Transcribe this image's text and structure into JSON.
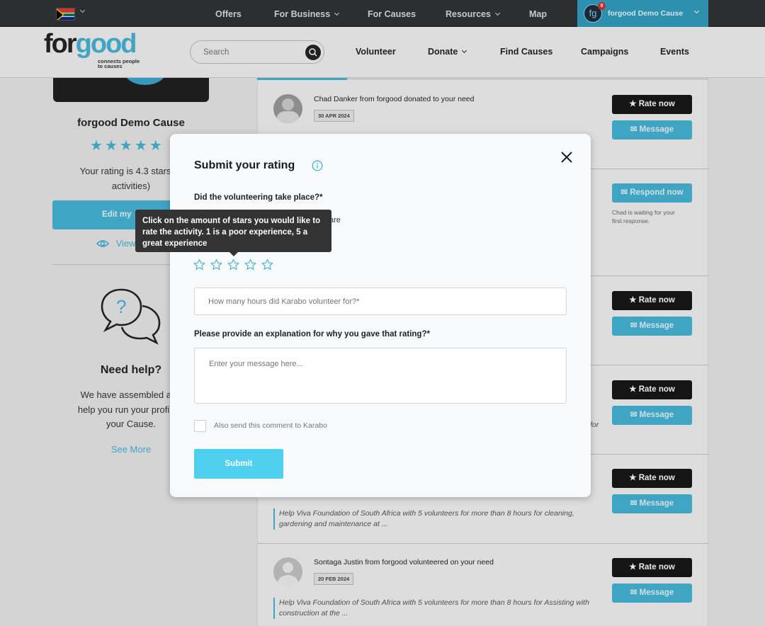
{
  "topbar": {
    "nav": [
      "Offers",
      "For Business",
      "For Causes",
      "Resources",
      "Map"
    ],
    "account_name": "forgood Demo Cause",
    "notification_count": "9",
    "avatar_letter": "fg"
  },
  "header": {
    "logo_text": "forgood",
    "logo_tagline_1": "connects people",
    "logo_tagline_2": "to causes",
    "search_placeholder": "Search",
    "nav": [
      "Volunteer",
      "Donate",
      "Find Causes",
      "Campaigns",
      "Events"
    ]
  },
  "sidebar": {
    "cause_name": "forgood Demo Cause",
    "rating_text_1": "Your rating is 4.3 stars (fr",
    "rating_text_2": "activities)",
    "edit_button": "Edit my",
    "view_link": "View",
    "help_title": "Need help?",
    "help_text_1": "We have assembled a to",
    "help_text_2": "help you run your profile a",
    "help_text_3": "your Cause.",
    "see_more": "See More"
  },
  "feed": {
    "rate_now": "★ Rate now",
    "message": "Message",
    "respond_now": "Respond now",
    "waiting_text_1": "Chad is waiting for your",
    "waiting_text_2": "first response.",
    "item1_title": "Chad Danker from forgood donated to your need",
    "item1_date": "30 APR 2024",
    "partial_for": "for",
    "item5_desc_1": "Help Viva Foundation of South Africa with 5 volunteers for more than 8 hours for cleaning,",
    "item5_desc_2": "gardening and maintenance at ...",
    "item6_title": "Sontaga Justin from forgood volunteered on your need",
    "item6_date": "20 FEB 2024",
    "item6_desc_1": "Help Viva Foundation of South Africa with 5 volunteers for more than 8 hours for Assisting with",
    "item6_desc_2": "construction at the ..."
  },
  "modal": {
    "title": "Submit your rating",
    "question1": "Did the volunteering take place?*",
    "partial_option": "are",
    "tooltip": "Click on the amount of stars you would like to rate the activity. 1 is a poor experience, 5 a great experience",
    "hours_placeholder": "How many hours did Karabo volunteer for?*",
    "explanation_label": "Please provide an explanation for why you gave that rating?*",
    "message_placeholder": "Enter your message here...",
    "checkbox_label": "Also send this comment to Karabo",
    "submit": "Submit",
    "rating_selected": 0,
    "rating_max": 5
  },
  "colors": {
    "accent": "#44b4d6",
    "dark": "#151515",
    "topbar": "#2f3033"
  }
}
